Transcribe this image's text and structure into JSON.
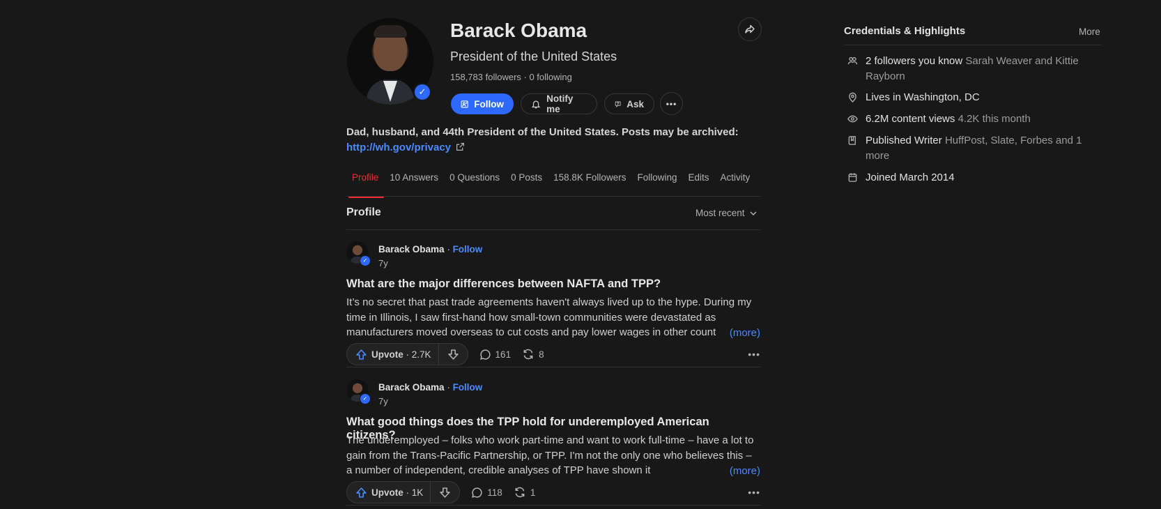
{
  "profile": {
    "name": "Barack Obama",
    "title": "President of the United States",
    "counts": "158,783 followers · 0 following",
    "bio_text": "Dad, husband, and 44th President of the United States. Posts may be archived:",
    "bio_link": "http://wh.gov/privacy"
  },
  "buttons": {
    "follow": "Follow",
    "notify": "Notify me",
    "ask": "Ask",
    "more": "•••"
  },
  "tabs": [
    {
      "label": "Profile"
    },
    {
      "label": "10 Answers"
    },
    {
      "label": "0 Questions"
    },
    {
      "label": "0 Posts"
    },
    {
      "label": "158.8K Followers"
    },
    {
      "label": "Following"
    },
    {
      "label": "Edits"
    },
    {
      "label": "Activity"
    }
  ],
  "feed": {
    "section_title": "Profile",
    "sort_label": "Most recent"
  },
  "posts": [
    {
      "author": "Barack Obama",
      "follow": "Follow",
      "time": "7y",
      "question": "What are the major differences between NAFTA and TPP?",
      "excerpt": "It’s no secret that past trade agreements haven't always lived up to the hype. During my time in Illinois, I saw first-hand how small-town communities were devastated as manufacturers moved overseas to cut costs and pay lower wages in other count",
      "more": "(more)",
      "upvote_label": "Upvote",
      "upvotes": "2.7K",
      "comments": "161",
      "shares": "8"
    },
    {
      "author": "Barack Obama",
      "follow": "Follow",
      "time": "7y",
      "question": "What good things does the TPP hold for underemployed American citizens?",
      "excerpt": "The underemployed – folks who work part-time and want to work full-time – have a lot to gain from the Trans-Pacific Partnership, or TPP. I'm not the only one who believes this – a number of independent, credible analyses of TPP have shown it",
      "more": "(more)",
      "upvote_label": "Upvote",
      "upvotes": "1K",
      "comments": "118",
      "shares": "1"
    }
  ],
  "credentials": {
    "title": "Credentials & Highlights",
    "more": "More",
    "items": [
      {
        "icon": "followers-icon",
        "main": "2 followers you know",
        "muted": "Sarah Weaver and Kittie Rayborn"
      },
      {
        "icon": "location-icon",
        "main": "Lives in Washington, DC",
        "muted": ""
      },
      {
        "icon": "eye-icon",
        "main": "6.2M content views",
        "muted": "4.2K this month"
      },
      {
        "icon": "book-icon",
        "main": "Published Writer",
        "muted": "HuffPost, Slate, Forbes and 1 more"
      },
      {
        "icon": "calendar-icon",
        "main": "Joined March 2014",
        "muted": ""
      }
    ]
  },
  "colors": {
    "background": "#181818",
    "accent_blue": "#2e69ff",
    "link_blue": "#4b8bff",
    "active_tab_red": "#f52936"
  }
}
